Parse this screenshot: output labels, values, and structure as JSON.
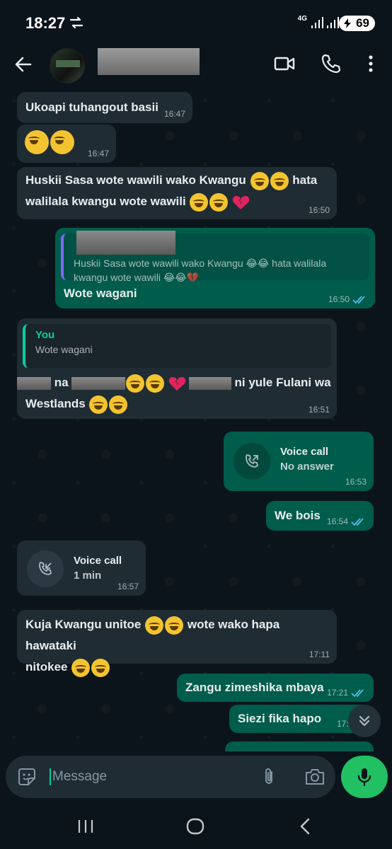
{
  "status": {
    "time": "18:27",
    "network": "4G",
    "battery": "69"
  },
  "header": {
    "title": ""
  },
  "messages": {
    "m1": {
      "text": "Ukoapi tuhangout basii",
      "time": "16:47"
    },
    "m2": {
      "time": "16:47"
    },
    "m3": {
      "text_a": "Huskii Sasa wote wawili wako Kwangu",
      "text_b": "hata",
      "text_c": "walilala kwangu wote wawili",
      "time": "16:50"
    },
    "m4": {
      "quote": "Huskii Sasa wote wawili wako Kwangu 😂😂 hata walilala kwangu wote wawili 😂😂💔",
      "text": "Wote wagani",
      "time": "16:50"
    },
    "m5": {
      "quote_name": "You",
      "quote_text": "Wote wagani",
      "text_a": "na",
      "text_b": "ni yule Fulani wa",
      "text_c": "Westlands",
      "time": "16:51"
    },
    "m6": {
      "title": "Voice call",
      "sub": "No answer",
      "time": "16:53"
    },
    "m7": {
      "text": "We bois",
      "time": "16:54"
    },
    "m8": {
      "title": "Voice call",
      "sub": "1 min",
      "time": "16:57"
    },
    "m9": {
      "text_a": "Kuja Kwangu unitoe",
      "text_b": "wote wako hapa hawataki",
      "text_c": "nitokee",
      "time": "17:11"
    },
    "m10": {
      "text": "Zangu zimeshika mbaya",
      "time": "17:21"
    },
    "m11": {
      "text": "Siezi fika hapo",
      "time": "17:21"
    }
  },
  "composer": {
    "placeholder": "Message"
  },
  "colors": {
    "incoming": "#1f2c34",
    "outgoing": "#005c4b",
    "accent": "#21c063",
    "read_ticks": "#53bdeb"
  }
}
